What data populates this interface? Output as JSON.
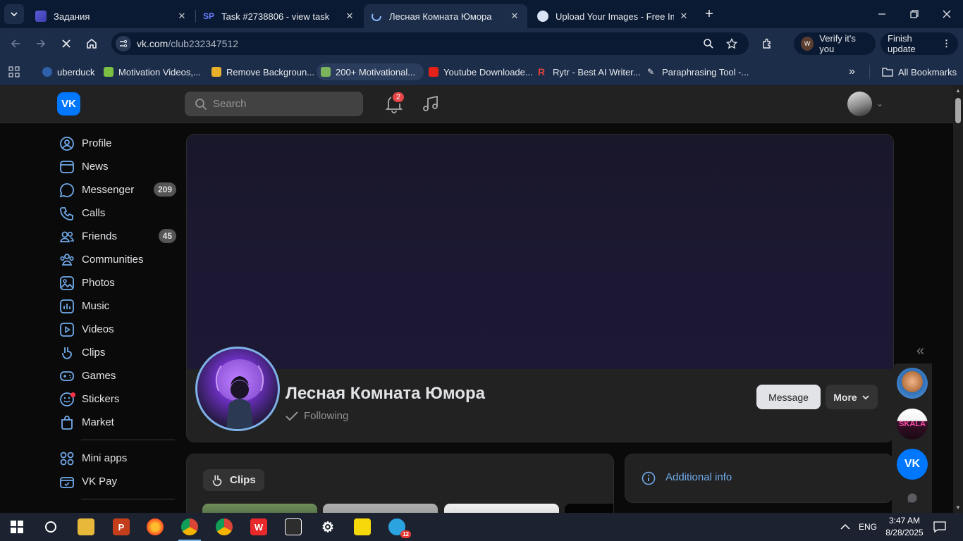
{
  "browser": {
    "tabs": [
      {
        "title": "Задания",
        "active": false
      },
      {
        "title": "Task #2738806 - view task",
        "active": false
      },
      {
        "title": "Лесная Комната Юмора",
        "active": true
      },
      {
        "title": "Upload Your Images - Free Imag",
        "active": false
      }
    ],
    "url_host": "vk.com",
    "url_path": "/club232347512",
    "profile_pill": "Verify it's you",
    "update_pill": "Finish update",
    "bookmarks": [
      "uberduck",
      "Motivation Videos,...",
      "Remove Backgroun...",
      "200+ Motivational...",
      "Youtube Downloade...",
      "Rytr - Best AI Writer...",
      "Paraphrasing Tool -..."
    ],
    "all_bookmarks": "All Bookmarks"
  },
  "vk": {
    "logo": "VK",
    "search_placeholder": "Search",
    "notifications_count": "2",
    "sidebar": [
      {
        "label": "Profile",
        "icon": "profile-icon"
      },
      {
        "label": "News",
        "icon": "news-icon"
      },
      {
        "label": "Messenger",
        "icon": "messenger-icon",
        "count": "209"
      },
      {
        "label": "Calls",
        "icon": "calls-icon"
      },
      {
        "label": "Friends",
        "icon": "friends-icon",
        "count": "45"
      },
      {
        "label": "Communities",
        "icon": "communities-icon"
      },
      {
        "label": "Photos",
        "icon": "photos-icon"
      },
      {
        "label": "Music",
        "icon": "music-icon"
      },
      {
        "label": "Videos",
        "icon": "videos-icon"
      },
      {
        "label": "Clips",
        "icon": "clips-icon"
      },
      {
        "label": "Games",
        "icon": "games-icon"
      },
      {
        "label": "Stickers",
        "icon": "stickers-icon"
      },
      {
        "label": "Market",
        "icon": "market-icon"
      }
    ],
    "sidebar_extra": [
      {
        "label": "Mini apps",
        "icon": "mini-apps-icon"
      },
      {
        "label": "VK Pay",
        "icon": "vk-pay-icon"
      }
    ],
    "group": {
      "name": "Лесная Комната Юмора",
      "status": "Following",
      "message_button": "Message",
      "more_button": "More"
    },
    "clips_label": "Clips",
    "additional_info": "Additional info",
    "right_avatars": [
      "user-avatar",
      "SKALA",
      "VK"
    ]
  },
  "taskbar": {
    "language": "ENG",
    "time": "3:47 AM",
    "date": "8/28/2025",
    "telegram_badge": "12"
  },
  "colors": {
    "vk_blue": "#0077ff",
    "link_blue": "#71aaeb",
    "badge_red": "#e64646",
    "chrome_dark": "#0b1a33"
  }
}
